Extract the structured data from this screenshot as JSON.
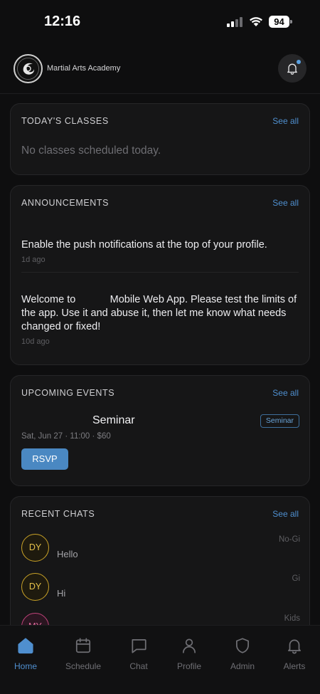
{
  "status_bar": {
    "time": "12:16",
    "battery": "94"
  },
  "header": {
    "brand": "Martial Arts Academy",
    "notification_dot_color": "#5aa0e0"
  },
  "todays_classes": {
    "title": "TODAY'S CLASSES",
    "see_all": "See all",
    "empty_text": "No classes scheduled today."
  },
  "announcements": {
    "title": "ANNOUNCEMENTS",
    "see_all": "See all",
    "items": [
      {
        "text": "Enable the push notifications at the top of your profile.",
        "time": "1d ago"
      },
      {
        "text": "Welcome to            Mobile Web App. Please test the limits of the app. Use it and abuse it, then let me know what needs changed or fixed!",
        "time": "10d ago"
      }
    ]
  },
  "upcoming_events": {
    "title": "UPCOMING EVENTS",
    "see_all": "See all",
    "event": {
      "name": "Seminar",
      "badge": "Seminar",
      "meta": "Sat, Jun 27 · 11:00 · $60",
      "rsvp_label": "RSVP"
    }
  },
  "recent_chats": {
    "title": "RECENT CHATS",
    "see_all": "See all",
    "items": [
      {
        "initials": "DY",
        "message": "Hello",
        "group": "No-Gi"
      },
      {
        "initials": "DY",
        "message": "Hi",
        "group": "Gi"
      },
      {
        "initials": "MY",
        "message": "",
        "group": "Kids"
      }
    ]
  },
  "nav": {
    "items": [
      {
        "label": "Home",
        "icon": "home-icon",
        "active": true
      },
      {
        "label": "Schedule",
        "icon": "calendar-icon"
      },
      {
        "label": "Chat",
        "icon": "chat-bubble-icon"
      },
      {
        "label": "Profile",
        "icon": "person-icon"
      },
      {
        "label": "Admin",
        "icon": "shield-icon"
      },
      {
        "label": "Alerts",
        "icon": "bell-icon"
      }
    ]
  },
  "colors": {
    "accent": "#4f8fcf",
    "background": "#0e0e0f",
    "card": "#161617"
  }
}
